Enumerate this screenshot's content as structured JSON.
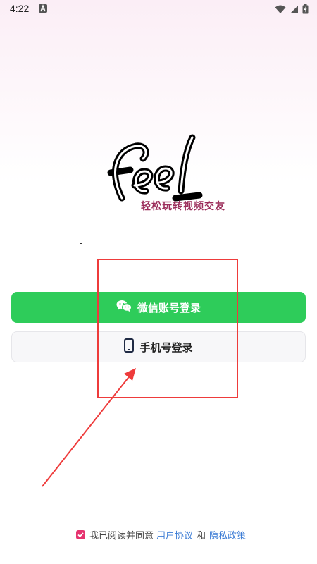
{
  "status_bar": {
    "time": "4:22",
    "icons": [
      "a-notification-icon",
      "wifi-icon",
      "signal-icon",
      "battery-icon"
    ]
  },
  "brand": {
    "logo_text": "feel",
    "tagline": "轻松玩转视频交友"
  },
  "login": {
    "wechat_label": "微信账号登录",
    "wechat_icon": "wechat-icon",
    "phone_label": "手机号登录",
    "phone_icon": "phone-icon"
  },
  "agreement": {
    "prefix": "我已阅读并同意",
    "user_agreement": "用户协议",
    "and": "和",
    "privacy_policy": "隐私政策",
    "checked": true
  },
  "colors": {
    "wechat_green": "#2ecc5a",
    "annotation_red": "#ee3b3b",
    "link_blue": "#3a7bd5",
    "checkbox_pink": "#e6336f",
    "tagline_color": "#9b2c5a"
  }
}
